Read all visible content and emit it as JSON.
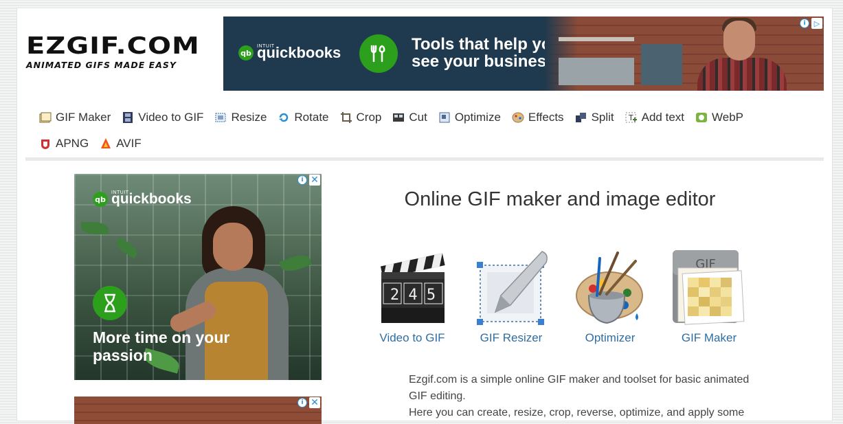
{
  "logo": {
    "main": "EZGIF.COM",
    "tagline": "ANIMATED GIFS MADE EASY"
  },
  "top_ad": {
    "brand_small": "INTUIT",
    "brand": "quickbooks",
    "headline": "Tools that help you see your business",
    "info_icon": "info-icon",
    "adchoices_icon": "adchoices-icon"
  },
  "nav": {
    "row1": [
      {
        "label": "GIF Maker",
        "icon": "gif-maker-icon",
        "color": "#7a6a3a"
      },
      {
        "label": "Video to GIF",
        "icon": "film-icon",
        "color": "#2f3b5a"
      },
      {
        "label": "Resize",
        "icon": "resize-icon",
        "color": "#3a6ea5"
      },
      {
        "label": "Rotate",
        "icon": "rotate-icon",
        "color": "#2a8fd0"
      },
      {
        "label": "Crop",
        "icon": "crop-icon",
        "color": "#6a5a4a"
      },
      {
        "label": "Cut",
        "icon": "cut-icon",
        "color": "#3a3a3a"
      },
      {
        "label": "Optimize",
        "icon": "optimize-icon",
        "color": "#4a6a9a"
      },
      {
        "label": "Effects",
        "icon": "palette-icon",
        "color": "#a07a40"
      },
      {
        "label": "Split",
        "icon": "split-icon",
        "color": "#2f3b5a"
      },
      {
        "label": "Add text",
        "icon": "add-text-icon",
        "color": "#4a7a3a"
      },
      {
        "label": "WebP",
        "icon": "webp-icon",
        "color": "#7cb342"
      }
    ],
    "row2": [
      {
        "label": "APNG",
        "icon": "apng-icon",
        "color": "#d32f2f"
      },
      {
        "label": "AVIF",
        "icon": "avif-icon",
        "color": "#f4511e"
      }
    ]
  },
  "side_ad": {
    "brand_small": "INTUIT",
    "brand": "quickbooks",
    "headline": "More time on your passion"
  },
  "main": {
    "title": "Online GIF maker and image editor",
    "tools": [
      {
        "label": "Video to GIF",
        "icon": "clapperboard-icon"
      },
      {
        "label": "GIF Resizer",
        "icon": "resizer-pen-icon"
      },
      {
        "label": "Optimizer",
        "icon": "paint-bucket-icon"
      },
      {
        "label": "GIF Maker",
        "icon": "gif-frames-icon"
      }
    ],
    "clapper_digits": "2 4 5",
    "gif_badge": "GIF",
    "description": [
      "Ezgif.com is a simple online GIF maker and toolset for basic animated",
      "GIF editing.",
      "Here you can create, resize, crop, reverse, optimize, and apply some"
    ]
  },
  "colors": {
    "link": "#2e6da4",
    "quickbooks_green": "#2ca01c",
    "ad_navy": "#1f3a4e"
  }
}
